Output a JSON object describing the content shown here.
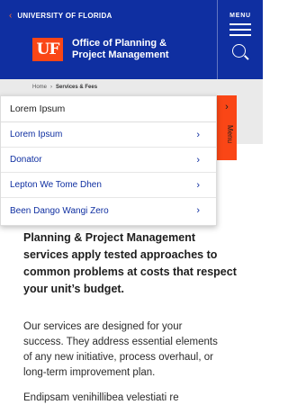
{
  "header": {
    "university_link": "UNIVERSITY OF FLORIDA",
    "logo_text": "UF",
    "office_line1": "Office of Planning &",
    "office_line2": "Project Management",
    "menu_label": "MENU"
  },
  "breadcrumb": {
    "home": "Home",
    "separator": "›",
    "current": "Services & Fees"
  },
  "side_tab": {
    "label": "Menu"
  },
  "dropdown": {
    "heading": "Lorem Ipsum",
    "items": [
      {
        "label": "Lorem Ipsum"
      },
      {
        "label": "Donator"
      },
      {
        "label": "Lepton We Tome Dhen"
      },
      {
        "label": "Been Dango Wangi Zero"
      }
    ]
  },
  "content": {
    "lead_lines": [
      "Planning & Project Management",
      "services apply tested approaches to",
      "common problems at costs that respect",
      "your unit’s budget."
    ],
    "body_lines": [
      "Our services are designed for your",
      "success. They address essential elements",
      "of any new initiative, process overhaul, or",
      "long-term improvement plan."
    ],
    "partial_line": "Endipsam venihillibea velestiati re"
  },
  "colors": {
    "brand_blue": "#0f2fa1",
    "accent_orange": "#fa4616",
    "breadcrumb_band": "#eaeaea"
  },
  "icons": {
    "back": "chevron-left-icon",
    "menu": "hamburger-icon",
    "search": "search-icon",
    "item": "chevron-right-icon"
  }
}
